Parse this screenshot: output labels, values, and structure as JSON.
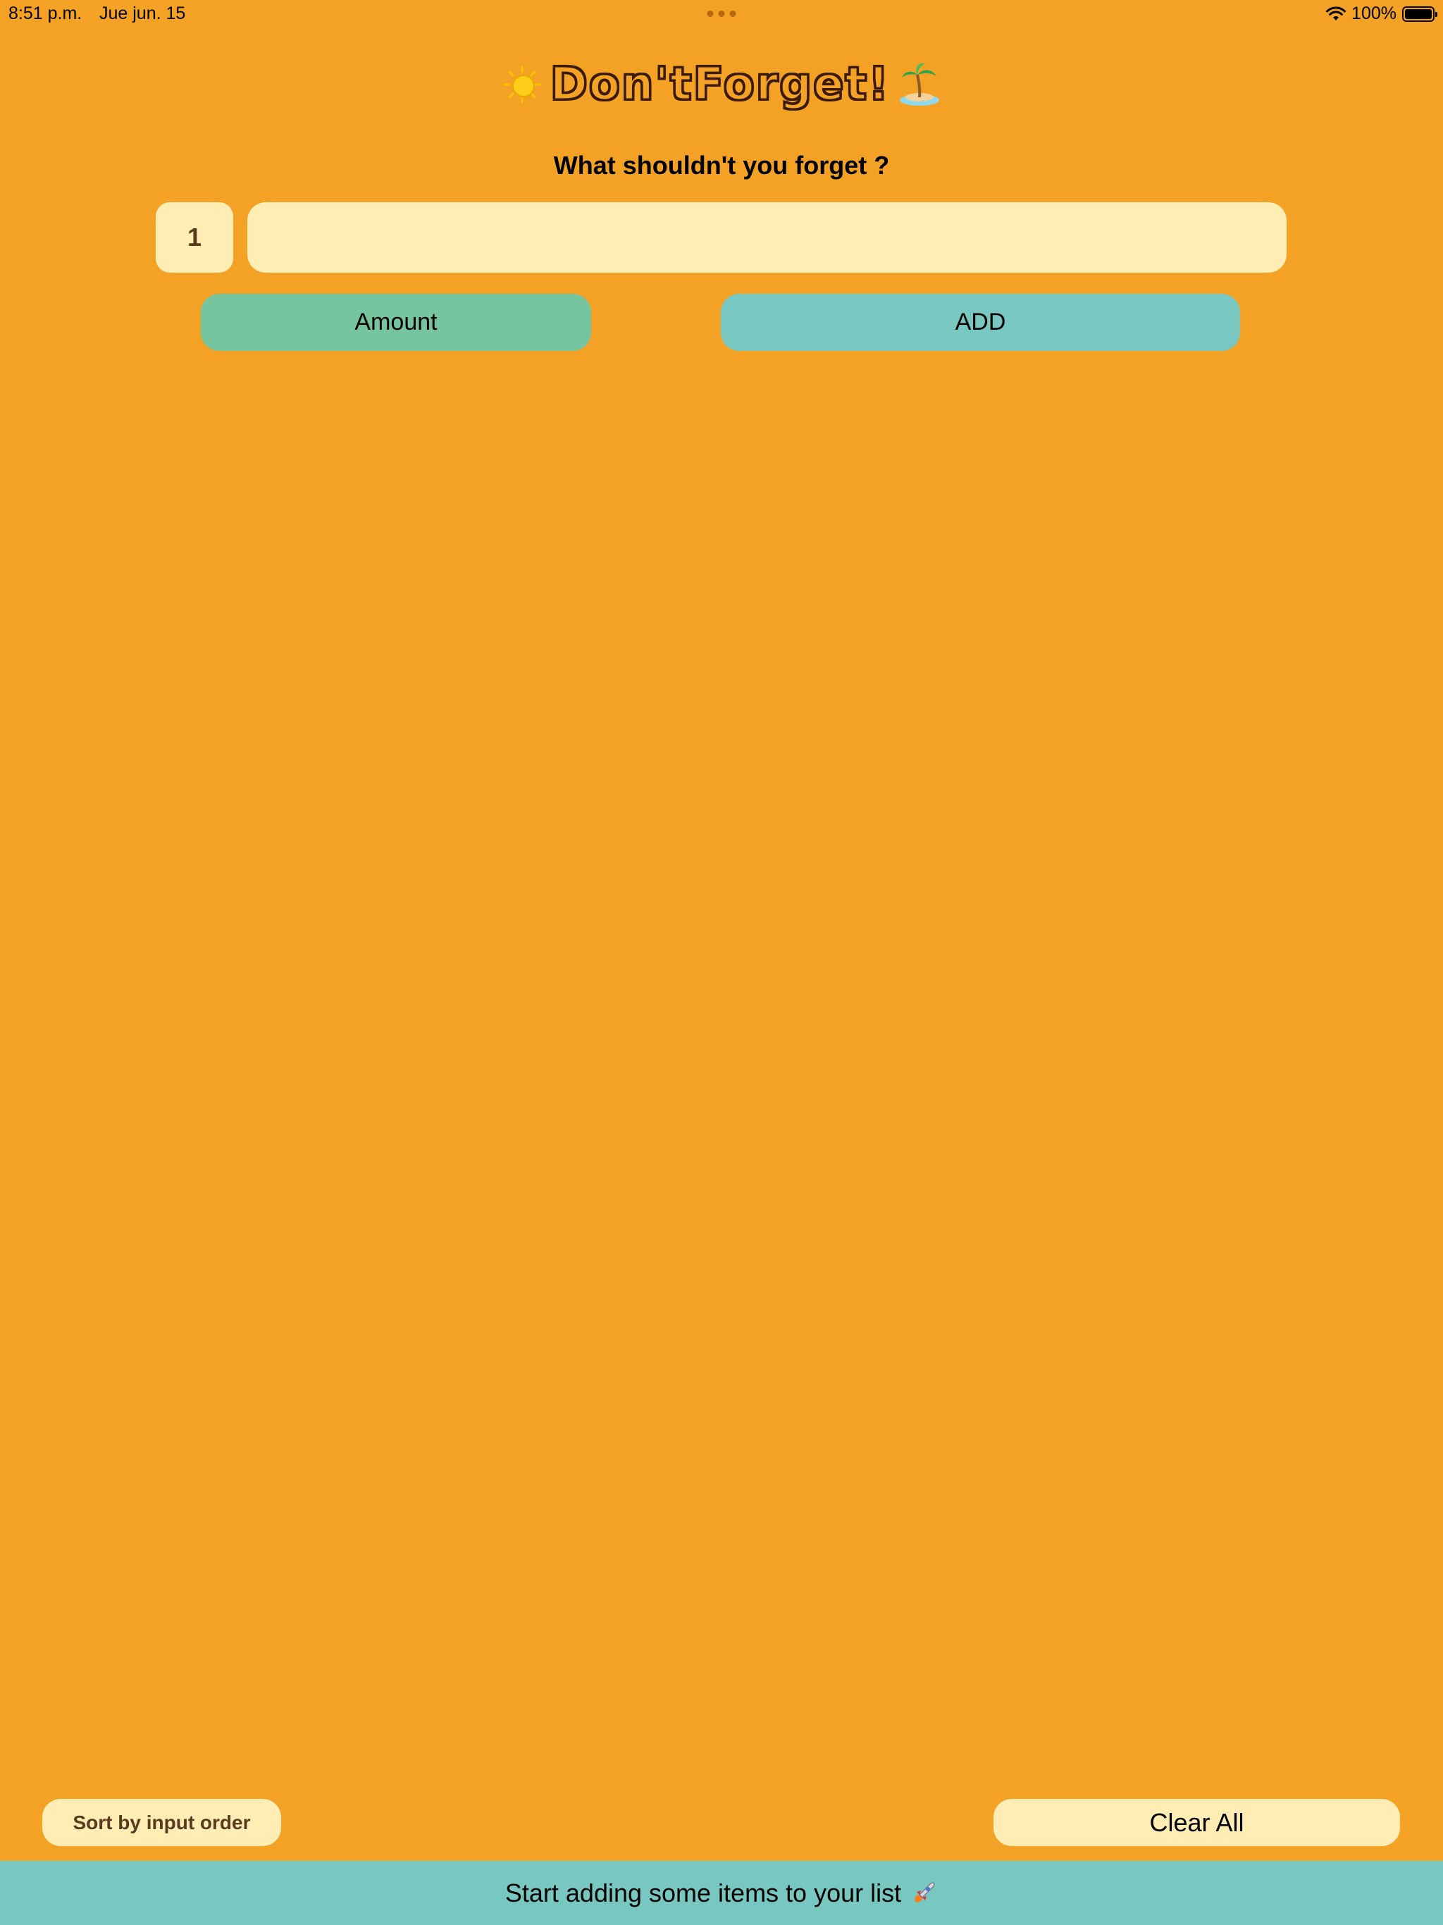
{
  "status_bar": {
    "time": "8:51 p.m.",
    "date": "Jue jun. 15",
    "battery": "100%"
  },
  "header": {
    "title": "Don'tForget!",
    "prompt": "What shouldn't you forget ?",
    "left_icon": "sun-icon",
    "right_icon": "island-icon"
  },
  "form": {
    "amount_value": "1",
    "item_value": "",
    "item_placeholder": "",
    "amount_button": "Amount",
    "add_button": "ADD"
  },
  "footer": {
    "sort_button": "Sort by input order",
    "clear_button": "Clear All",
    "empty_message": "Start adding some items to your list",
    "empty_icon": "rocket-icon"
  },
  "colors": {
    "background": "#f4a225",
    "input_bg": "#ffedb3",
    "amount_button": "#77c59f",
    "add_button": "#78c8c1",
    "footer_banner": "#78c8c1"
  }
}
